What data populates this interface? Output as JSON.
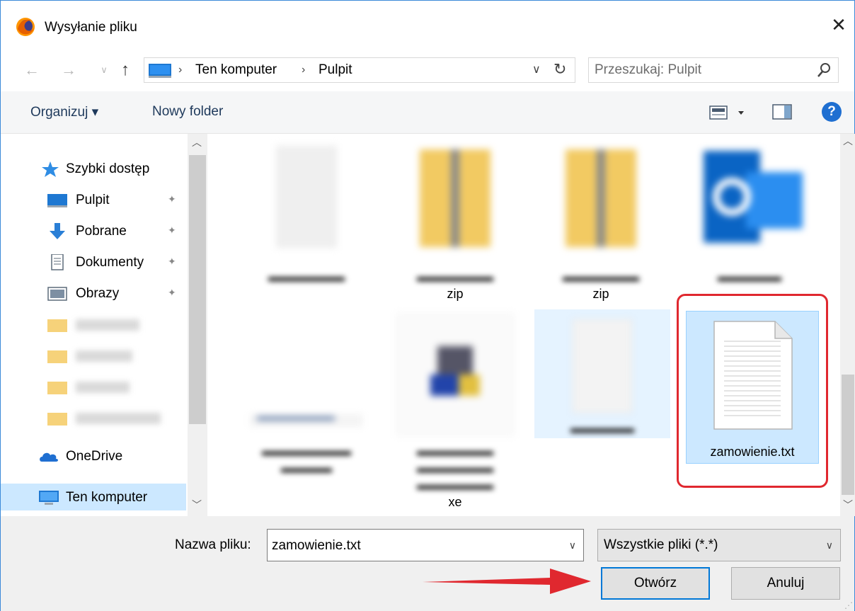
{
  "window": {
    "title": "Wysyłanie pliku",
    "close_label": "✕"
  },
  "navigation": {
    "back_icon": "←",
    "forward_icon": "→",
    "recent_icon": "∨",
    "up_icon": "↑",
    "breadcrumb": [
      "Ten komputer",
      "Pulpit"
    ],
    "separator": "›",
    "dropdown_icon": "∨",
    "refresh_icon": "↻"
  },
  "search": {
    "placeholder": "Przeszukaj: Pulpit"
  },
  "toolbar": {
    "organize_label": "Organizuj ▾",
    "new_folder_label": "Nowy folder",
    "help_label": "?"
  },
  "sidebar": {
    "quick_access": "Szybki dostęp",
    "items": [
      {
        "label": "Pulpit",
        "pinned": true
      },
      {
        "label": "Pobrane",
        "pinned": true
      },
      {
        "label": "Dokumenty",
        "pinned": true
      },
      {
        "label": "Obrazy",
        "pinned": true
      }
    ],
    "onedrive": "OneDrive",
    "this_pc": "Ten komputer",
    "pin_icon": "📌"
  },
  "files": [
    {
      "name_visible": "",
      "type": "document"
    },
    {
      "name_visible": "zip",
      "type": "zip-folder"
    },
    {
      "name_visible": "zip",
      "type": "zip-folder"
    },
    {
      "name_visible": "",
      "type": "outlook"
    },
    {
      "name_visible": "",
      "type": "image"
    },
    {
      "name_visible": "xe",
      "type": "installer"
    },
    {
      "name_visible": "",
      "type": "document"
    },
    {
      "name_visible": "zamowienie.txt",
      "type": "text",
      "selected": true
    }
  ],
  "bottom": {
    "filename_label": "Nazwa pliku:",
    "filename_value": "zamowienie.txt",
    "filetype_label": "Wszystkie pliki (*.*)",
    "open_label": "Otwórz",
    "cancel_label": "Anuluj"
  },
  "colors": {
    "accent": "#0078d7",
    "selection": "#cce8ff",
    "highlight_box": "#e0282f",
    "arrow": "#e0282f"
  }
}
